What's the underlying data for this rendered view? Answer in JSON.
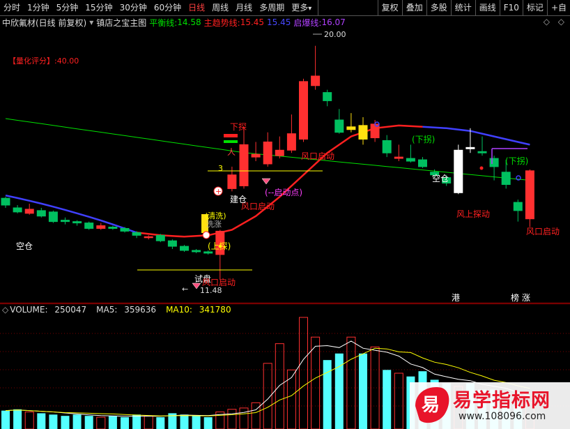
{
  "toolbar": {
    "periods": [
      "分时",
      "1分钟",
      "5分钟",
      "15分钟",
      "30分钟",
      "60分钟",
      "日线",
      "周线",
      "月线",
      "多周期",
      "更多"
    ],
    "active_period": "日线",
    "more_arrow": "▾",
    "right_buttons": [
      "复权",
      "叠加",
      "多股",
      "统计",
      "画线",
      "F10",
      "标记",
      "+自"
    ]
  },
  "infobar": {
    "stock_title": "中欣氟材(日线 前复权)",
    "indicator_name": "镇店之宝主图",
    "balance_label": "平衡线:",
    "balance_value": "14.58",
    "trend_label": "主趋势线:",
    "trend_value": "15.45",
    "extra_value": "15.45",
    "burst_label": "启爆线:",
    "burst_value": "16.07",
    "window_controls": "◇ ◇"
  },
  "main_labels": {
    "score": "【量化评分】:40.00",
    "high_price": "20.00",
    "low_price": "11.48",
    "left_arrow": "←",
    "kongcang": "空仓",
    "shipan": "试盘",
    "fengkou_qidong": "风口启动",
    "jiancang": "建仓",
    "xiatan": "下探",
    "qidongdian": "(--启动点)",
    "shangtan": "(上探)",
    "xiaguai": "(下拐)",
    "fengshangtan": "风上探动",
    "mark_3": "3",
    "qingxi": "(清洗)",
    "xizhang": "洗涨",
    "gang": "港",
    "bang": "榜",
    "zhang": "涨"
  },
  "volume": {
    "label": "VOLUME:",
    "value": "250047",
    "ma5_label": "MA5:",
    "ma5_value": "359636",
    "ma10_label": "MA10:",
    "ma10_value": "341780"
  },
  "watermark": {
    "text": "易学指标网",
    "url": "www.108096.com",
    "logo_char": "易"
  },
  "colors": {
    "up": "#ff3030",
    "down": "#00c060",
    "balance": "#00e000",
    "trend": "#ff2020",
    "extra": "#4040ff",
    "burst": "#b040ff",
    "yellow": "#ffff00",
    "cyan": "#54ffff"
  },
  "chart_data": {
    "type": "candlestick",
    "price_range": [
      11.0,
      20.5
    ],
    "candles": [
      {
        "o": 14.45,
        "c": 14.2,
        "h": 14.5,
        "l": 14.1
      },
      {
        "o": 14.1,
        "c": 13.95,
        "h": 14.2,
        "l": 13.9
      },
      {
        "o": 13.9,
        "c": 14.05,
        "h": 14.25,
        "l": 13.85
      },
      {
        "o": 14.0,
        "c": 13.8,
        "h": 14.1,
        "l": 13.75
      },
      {
        "o": 13.95,
        "c": 13.6,
        "h": 14.0,
        "l": 13.55
      },
      {
        "o": 13.65,
        "c": 13.6,
        "h": 13.75,
        "l": 13.5
      },
      {
        "o": 13.6,
        "c": 13.55,
        "h": 13.65,
        "l": 13.45
      },
      {
        "o": 13.55,
        "c": 13.35,
        "h": 13.6,
        "l": 13.3
      },
      {
        "o": 13.35,
        "c": 13.45,
        "h": 13.55,
        "l": 13.3
      },
      {
        "o": 13.4,
        "c": 13.35,
        "h": 13.45,
        "l": 13.3
      },
      {
        "o": 13.35,
        "c": 13.25,
        "h": 13.4,
        "l": 13.2
      },
      {
        "o": 13.2,
        "c": 13.1,
        "h": 13.25,
        "l": 13.0
      },
      {
        "o": 13.05,
        "c": 13.05,
        "h": 13.1,
        "l": 12.95
      },
      {
        "o": 13.1,
        "c": 12.9,
        "h": 13.15,
        "l": 12.85
      },
      {
        "o": 12.9,
        "c": 12.7,
        "h": 12.95,
        "l": 12.6
      },
      {
        "o": 12.7,
        "c": 12.55,
        "h": 12.75,
        "l": 12.5
      },
      {
        "o": 12.55,
        "c": 12.5,
        "h": 12.6,
        "l": 12.45
      },
      {
        "o": 12.5,
        "c": 12.45,
        "h": 12.55,
        "l": 12.4
      },
      {
        "o": 12.4,
        "c": 13.25,
        "h": 13.3,
        "l": 11.48
      },
      {
        "o": 14.8,
        "c": 15.3,
        "h": 15.6,
        "l": 14.7
      },
      {
        "o": 14.9,
        "c": 16.4,
        "h": 17.0,
        "l": 14.8
      },
      {
        "o": 15.95,
        "c": 16.05,
        "h": 16.5,
        "l": 15.8
      },
      {
        "o": 15.7,
        "c": 16.5,
        "h": 16.85,
        "l": 15.6
      },
      {
        "o": 16.0,
        "c": 16.2,
        "h": 16.7,
        "l": 15.9
      },
      {
        "o": 16.2,
        "c": 16.8,
        "h": 17.5,
        "l": 16.1
      },
      {
        "o": 16.6,
        "c": 18.7,
        "h": 18.8,
        "l": 16.5
      },
      {
        "o": 18.55,
        "c": 18.9,
        "h": 20.0,
        "l": 18.4
      },
      {
        "o": 18.3,
        "c": 18.0,
        "h": 18.4,
        "l": 17.8
      },
      {
        "o": 17.3,
        "c": 16.85,
        "h": 17.7,
        "l": 16.8
      },
      {
        "o": 16.95,
        "c": 17.05,
        "h": 17.55,
        "l": 16.85
      },
      {
        "o": 17.1,
        "c": 16.6,
        "h": 17.4,
        "l": 16.4
      },
      {
        "o": 16.65,
        "c": 17.15,
        "h": 17.3,
        "l": 16.5
      },
      {
        "o": 16.55,
        "c": 16.1,
        "h": 16.75,
        "l": 15.95
      },
      {
        "o": 15.9,
        "c": 15.95,
        "h": 16.4,
        "l": 15.8
      },
      {
        "o": 15.9,
        "c": 15.8,
        "h": 16.4,
        "l": 15.75
      },
      {
        "o": 15.85,
        "c": 15.6,
        "h": 15.95,
        "l": 15.55
      },
      {
        "o": 15.4,
        "c": 15.3,
        "h": 15.5,
        "l": 15.2
      },
      {
        "o": 15.2,
        "c": 15.0,
        "h": 15.3,
        "l": 14.9
      },
      {
        "o": 14.65,
        "c": 16.2,
        "h": 16.4,
        "l": 14.6
      },
      {
        "o": 16.3,
        "c": 16.25,
        "h": 17.0,
        "l": 16.1
      },
      {
        "o": 16.15,
        "c": 16.1,
        "h": 16.7,
        "l": 16.0
      },
      {
        "o": 15.9,
        "c": 15.6,
        "h": 16.0,
        "l": 15.1
      },
      {
        "o": 15.4,
        "c": 14.95,
        "h": 15.85,
        "l": 14.8
      },
      {
        "o": 14.3,
        "c": 14.0,
        "h": 14.4,
        "l": 13.6
      },
      {
        "o": 13.7,
        "c": 15.45,
        "h": 15.5,
        "l": 13.4
      }
    ],
    "volume": [
      28,
      30,
      26,
      24,
      22,
      20,
      22,
      20,
      18,
      20,
      18,
      22,
      20,
      18,
      24,
      22,
      20,
      18,
      26,
      30,
      32,
      40,
      100,
      130,
      90,
      170,
      140,
      105,
      115,
      140,
      115,
      125,
      90,
      85,
      80,
      88,
      75,
      70,
      65,
      70,
      60,
      60,
      55,
      35,
      40
    ],
    "volume_range": [
      0,
      170
    ]
  }
}
